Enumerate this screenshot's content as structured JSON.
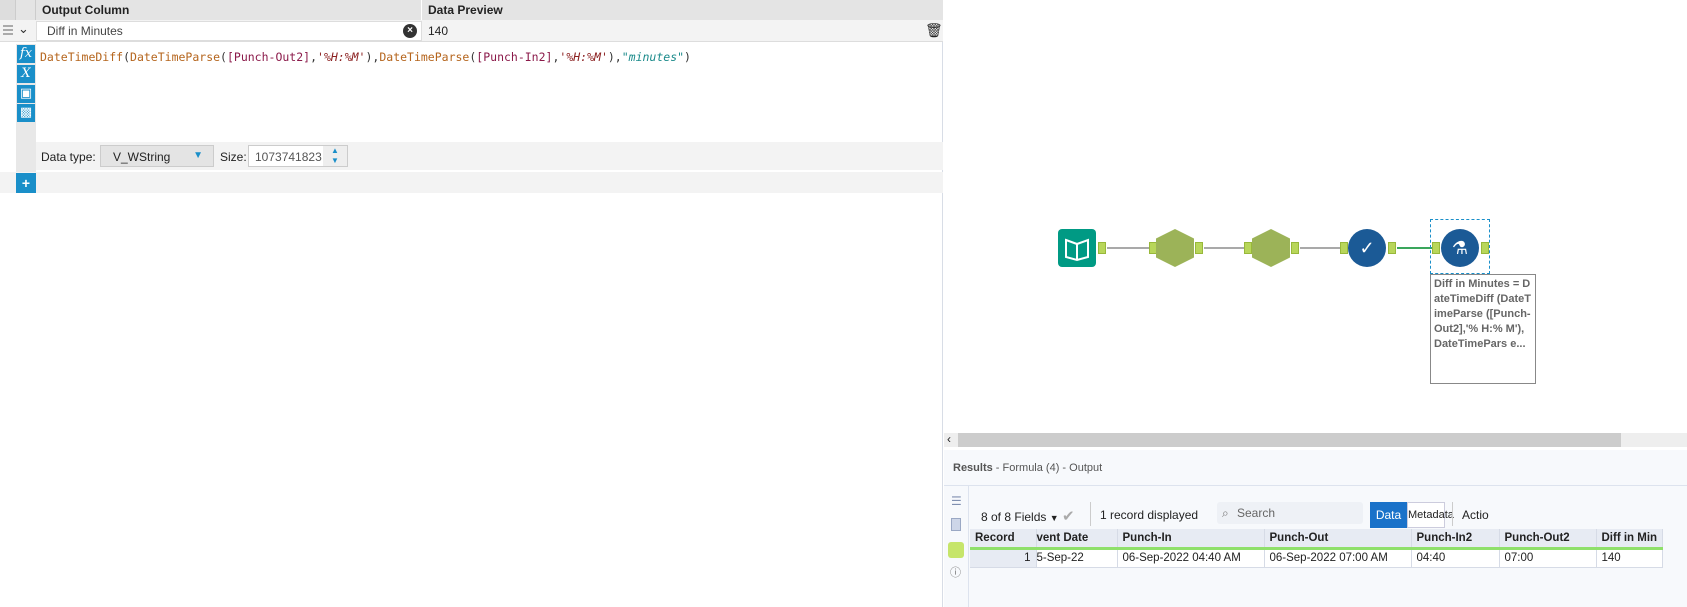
{
  "formula_panel": {
    "headers": {
      "output_column": "Output Column",
      "data_preview": "Data Preview"
    },
    "row": {
      "output_column_value": "Diff in Minutes",
      "preview_value": "140"
    },
    "expression": {
      "f1": "DateTimeDiff",
      "p1": "(",
      "f2": "DateTimeParse",
      "p2": "(",
      "field1": "[Punch-Out2]",
      "c1": ",",
      "fmt1": "'%H:%M'",
      "p3": "),",
      "f3": "DateTimeParse",
      "p4": "(",
      "field2": "[Punch-In2]",
      "c2": ",",
      "fmt2": "'%H:%M'",
      "p5": "),",
      "unit": "\"minutes\"",
      "p6": ")"
    },
    "data_type_label": "Data type:",
    "data_type_value": "V_WString",
    "size_label": "Size:",
    "size_value": "1073741823",
    "add_label": "+"
  },
  "canvas": {
    "annotation": "Diff in Minutes = DateTimeDiff (DateTimeParse ([Punch-Out2],'% H:% M'),DateTimePars e..."
  },
  "results": {
    "title": "Results",
    "subtitle": " - Formula (4) - Output",
    "fields_label": "8 of 8 Fields",
    "records_label": "1 record displayed",
    "search_placeholder": "Search",
    "tab_data": "Data",
    "tab_metadata": "Metadata",
    "actions_label": "Actio",
    "columns": [
      "Record",
      "vent Date",
      "Punch-In",
      "Punch-Out",
      "Punch-In2",
      "Punch-Out2",
      "Diff in Min"
    ],
    "rows": [
      [
        "1",
        "5-Sep-22",
        "06-Sep-2022 04:40 AM",
        "06-Sep-2022 07:00 AM",
        "04:40",
        "07:00",
        "140"
      ]
    ]
  }
}
